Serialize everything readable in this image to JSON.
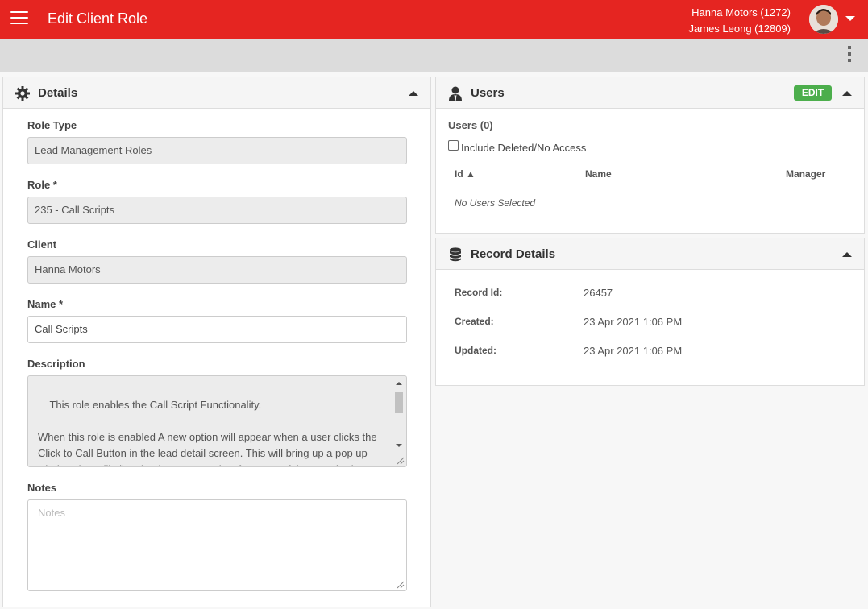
{
  "header": {
    "title": "Edit Client Role",
    "dealer": "Hanna Motors (1272)",
    "user": "James Leong (12809)"
  },
  "details": {
    "title": "Details",
    "role_type_label": "Role Type",
    "role_type_value": "Lead Management Roles",
    "role_label": "Role *",
    "role_value": "235 - Call Scripts",
    "client_label": "Client",
    "client_value": "Hanna Motors",
    "name_label": "Name *",
    "name_value": "Call Scripts",
    "description_label": "Description",
    "description_value": "This role enables the Call Script Functionality.\n\nWhen this role is enabled A new option will appear when a user clicks the Click to Call Button in the lead detail screen. This will bring up a pop up window that will allow for the user to select from any of the Standard Text Texas Call Script options that they available to use. The",
    "notes_label": "Notes",
    "notes_placeholder": "Notes"
  },
  "users": {
    "title": "Users",
    "edit_label": "EDIT",
    "count_label": "Users (0)",
    "include_deleted_label": "Include Deleted/No Access",
    "columns": {
      "id": "Id ▲",
      "name": "Name",
      "manager": "Manager"
    },
    "empty_text": "No Users Selected"
  },
  "record_details": {
    "title": "Record Details",
    "record_id_label": "Record Id:",
    "record_id_value": "26457",
    "created_label": "Created:",
    "created_value": "23 Apr 2021 1:06 PM",
    "updated_label": "Updated:",
    "updated_value": "23 Apr 2021 1:06 PM"
  },
  "colors": {
    "brand_red": "#e52521",
    "edit_green": "#4cae4c"
  },
  "icons": {
    "menu": "hamburger-menu-icon",
    "details": "gear-icon",
    "users": "user-icon",
    "record": "database-icon"
  }
}
